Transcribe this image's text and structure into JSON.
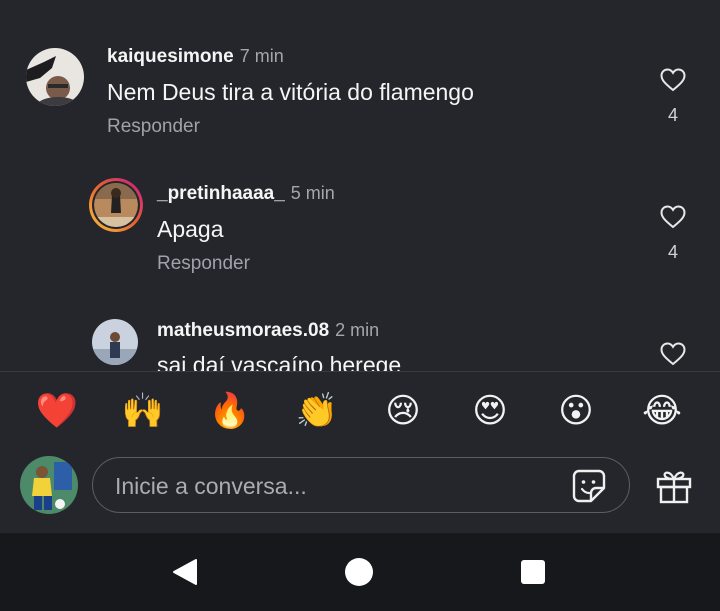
{
  "comments": [
    {
      "username": "kaiquesimone",
      "time": "7 min",
      "text": "Nem Deus tira a vitória do flamengo",
      "reply_label": "Responder",
      "likes": "4"
    },
    {
      "username": "_pretinhaaaa_",
      "time": "5 min",
      "text": "Apaga",
      "reply_label": "Responder",
      "likes": "4"
    },
    {
      "username": "matheusmoraes.08",
      "time": "2 min",
      "text": "sai daí vascaíno herege"
    }
  ],
  "reactions": [
    {
      "icon": "heart-icon",
      "glyph": "❤️"
    },
    {
      "icon": "raising-hands-icon",
      "glyph": "🙌"
    },
    {
      "icon": "fire-icon",
      "glyph": "🔥"
    },
    {
      "icon": "clapping-hands-icon",
      "glyph": "👏"
    },
    {
      "icon": "crying-face-icon",
      "glyph": "😢"
    },
    {
      "icon": "heart-eyes-icon",
      "glyph": "😍"
    },
    {
      "icon": "surprised-face-icon",
      "glyph": "😮"
    },
    {
      "icon": "laughing-tears-icon",
      "glyph": "😂"
    }
  ],
  "composer": {
    "placeholder": "Inicie a conversa..."
  },
  "colors": {
    "background": "#25262b",
    "navbar": "#17181b",
    "muted_text": "#9ea2aa",
    "story_ring_start": "#f9c240",
    "story_ring_end": "#c3178f"
  }
}
